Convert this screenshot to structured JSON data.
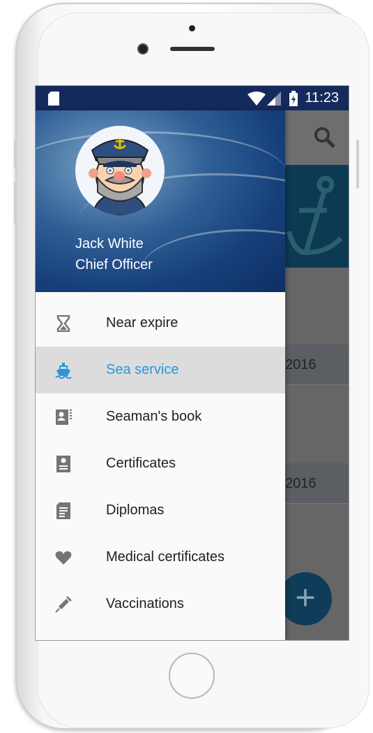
{
  "status_bar": {
    "time": "11:23",
    "icons": [
      "sd-card-icon",
      "wifi-icon",
      "signal-icon",
      "battery-charging-icon"
    ]
  },
  "profile": {
    "name": "Jack White",
    "rank": "Chief Officer"
  },
  "menu": [
    {
      "label": "Near expire",
      "icon": "hourglass-icon",
      "active": false
    },
    {
      "label": "Sea service",
      "icon": "ship-icon",
      "active": true
    },
    {
      "label": "Seaman's book",
      "icon": "id-book-icon",
      "active": false
    },
    {
      "label": "Certificates",
      "icon": "certificate-icon",
      "active": false
    },
    {
      "label": "Diplomas",
      "icon": "diploma-icon",
      "active": false
    },
    {
      "label": "Medical certificates",
      "icon": "heart-icon",
      "active": false
    },
    {
      "label": "Vaccinations",
      "icon": "syringe-icon",
      "active": false
    }
  ],
  "background": {
    "rows": [
      "2016",
      "2016"
    ],
    "fab_label": "+"
  },
  "colors": {
    "status_bar": "#152a5c",
    "accent": "#2a97d8",
    "fab": "#0f3c58"
  }
}
